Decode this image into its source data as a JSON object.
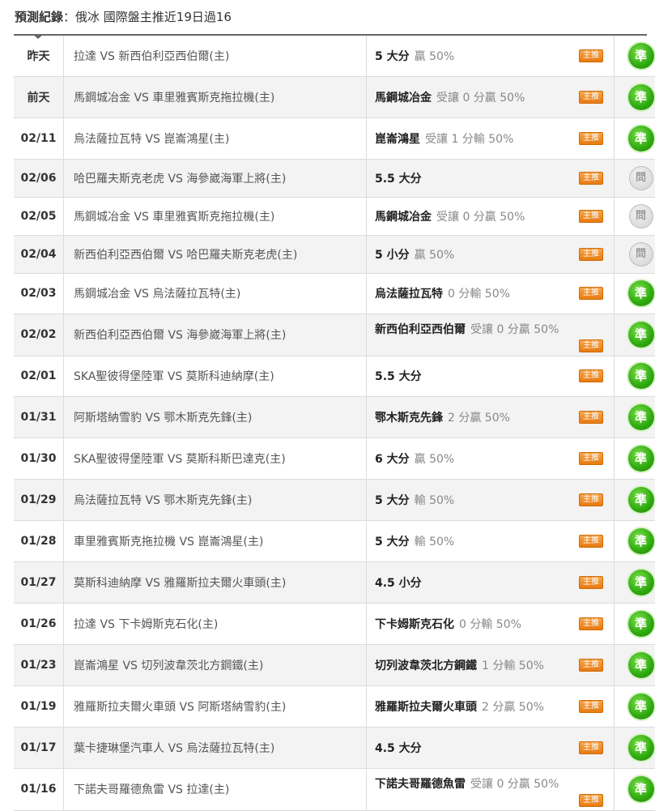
{
  "header": {
    "prefix": "預測紀錄",
    "separator": "：",
    "title": "俄冰 國際盤主推近19日過16"
  },
  "badge_label": "主推",
  "rows": [
    {
      "date": "昨天",
      "match": "拉達 VS 新西伯利亞西伯爾(主)",
      "pick_team": "5 大分",
      "pick_note": "贏 50%",
      "result": "準",
      "result_type": "hit"
    },
    {
      "date": "前天",
      "match": "馬鋼城冶金 VS 車里雅賓斯克拖拉機(主)",
      "pick_team": "馬鋼城冶金",
      "pick_note": "受讓 0 分贏 50%",
      "result": "準",
      "result_type": "hit"
    },
    {
      "date": "02/11",
      "match": "烏法薩拉瓦特 VS 崑崙鴻星(主)",
      "pick_team": "崑崙鴻星",
      "pick_note": "受讓 1 分輸 50%",
      "result": "準",
      "result_type": "hit"
    },
    {
      "date": "02/06",
      "match": "哈巴羅夫斯克老虎 VS 海參崴海軍上將(主)",
      "pick_team": "5.5 大分",
      "pick_note": "",
      "result": "問",
      "result_type": "push"
    },
    {
      "date": "02/05",
      "match": "馬鋼城冶金 VS 車里雅賓斯克拖拉機(主)",
      "pick_team": "馬鋼城冶金",
      "pick_note": "受讓 0 分贏 50%",
      "result": "問",
      "result_type": "push"
    },
    {
      "date": "02/04",
      "match": "新西伯利亞西伯爾 VS 哈巴羅夫斯克老虎(主)",
      "pick_team": "5 小分",
      "pick_note": "贏 50%",
      "result": "問",
      "result_type": "push"
    },
    {
      "date": "02/03",
      "match": "馬鋼城冶金 VS 烏法薩拉瓦特(主)",
      "pick_team": "烏法薩拉瓦特",
      "pick_note": "0 分輸 50%",
      "result": "準",
      "result_type": "hit"
    },
    {
      "date": "02/02",
      "match": "新西伯利亞西伯爾 VS 海參崴海軍上將(主)",
      "pick_team": "新西伯利亞西伯爾",
      "pick_note": "受讓 0 分贏 50%",
      "result": "準",
      "result_type": "hit",
      "wrap": true
    },
    {
      "date": "02/01",
      "match": "SKA聖彼得堡陸軍 VS 莫斯科迪納摩(主)",
      "pick_team": "5.5 大分",
      "pick_note": "",
      "result": "準",
      "result_type": "hit"
    },
    {
      "date": "01/31",
      "match": "阿斯塔納雪豹 VS 鄂木斯克先鋒(主)",
      "pick_team": "鄂木斯克先鋒",
      "pick_note": "2 分贏 50%",
      "result": "準",
      "result_type": "hit"
    },
    {
      "date": "01/30",
      "match": "SKA聖彼得堡陸軍 VS 莫斯科斯巴達克(主)",
      "pick_team": "6 大分",
      "pick_note": "贏 50%",
      "result": "準",
      "result_type": "hit"
    },
    {
      "date": "01/29",
      "match": "烏法薩拉瓦特 VS 鄂木斯克先鋒(主)",
      "pick_team": "5 大分",
      "pick_note": "輸 50%",
      "result": "準",
      "result_type": "hit"
    },
    {
      "date": "01/28",
      "match": "車里雅賓斯克拖拉機 VS 崑崙鴻星(主)",
      "pick_team": "5 大分",
      "pick_note": "輸 50%",
      "result": "準",
      "result_type": "hit"
    },
    {
      "date": "01/27",
      "match": "莫斯科迪納摩 VS 雅羅斯拉夫爾火車頭(主)",
      "pick_team": "4.5 小分",
      "pick_note": "",
      "result": "準",
      "result_type": "hit"
    },
    {
      "date": "01/26",
      "match": "拉達 VS 下卡姆斯克石化(主)",
      "pick_team": "下卡姆斯克石化",
      "pick_note": "0 分輸 50%",
      "result": "準",
      "result_type": "hit"
    },
    {
      "date": "01/23",
      "match": "崑崙鴻星 VS 切列波韋茨北方鋼鐵(主)",
      "pick_team": "切列波韋茨北方鋼鐵",
      "pick_note": "1 分輸 50%",
      "result": "準",
      "result_type": "hit"
    },
    {
      "date": "01/19",
      "match": "雅羅斯拉夫爾火車頭 VS 阿斯塔納雪豹(主)",
      "pick_team": "雅羅斯拉夫爾火車頭",
      "pick_note": "2 分贏 50%",
      "result": "準",
      "result_type": "hit"
    },
    {
      "date": "01/17",
      "match": "葉卡捷琳堡汽車人 VS 烏法薩拉瓦特(主)",
      "pick_team": "4.5 大分",
      "pick_note": "",
      "result": "準",
      "result_type": "hit"
    },
    {
      "date": "01/16",
      "match": "下諾夫哥羅德魚雷 VS 拉達(主)",
      "pick_team": "下諾夫哥羅德魚雷",
      "pick_note": "受讓 0 分贏 50%",
      "result": "準",
      "result_type": "hit",
      "wrap": true
    }
  ]
}
